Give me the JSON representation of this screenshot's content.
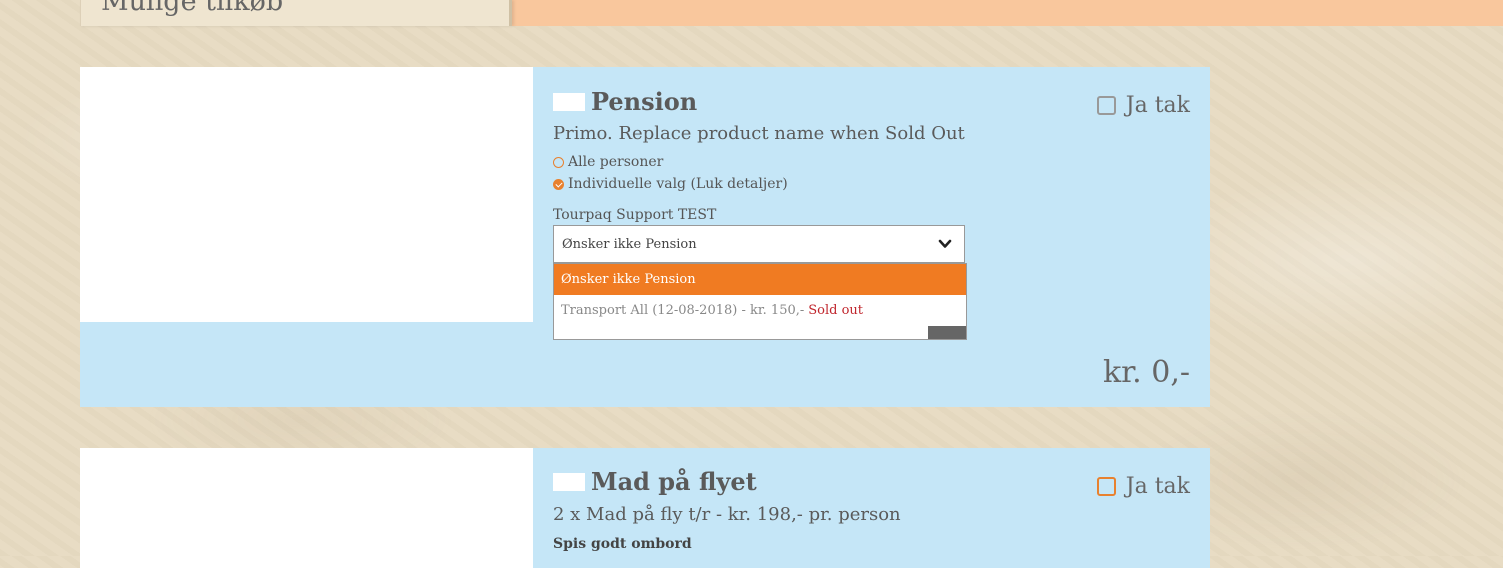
{
  "section": {
    "title": "Mulige tilkøb"
  },
  "products": [
    {
      "title": "Pension",
      "subtitle": "Primo. Replace product name when Sold Out",
      "checkbox_label": "Ja tak",
      "radio_options": [
        {
          "label": "Alle personer",
          "checked": false
        },
        {
          "label": "Individuelle valg (Luk detaljer)",
          "checked": true
        }
      ],
      "person_label": "Tourpaq Support TEST",
      "select": {
        "value": "Ønsker ikke Pension",
        "options": [
          {
            "label": "Ønsker ikke Pension",
            "selected": true
          },
          {
            "label": "Transport All (12-08-2018) - kr. 150,-",
            "status": "Sold out",
            "selected": false
          }
        ]
      },
      "price": "kr. 0,-"
    },
    {
      "title": "Mad på flyet",
      "subtitle": "2 x Mad på fly t/r - kr. 198,- pr. person",
      "checkbox_label": "Ja tak",
      "detail": "Spis godt ombord"
    }
  ],
  "colors": {
    "accent": "#f07b22",
    "card_bg": "#c5e6f7",
    "top_band": "#f9c79d",
    "sold_out": "#c0262d"
  },
  "icons": [
    "chevron-down-icon",
    "checkbox-icon",
    "radio-icon",
    "check-icon"
  ]
}
